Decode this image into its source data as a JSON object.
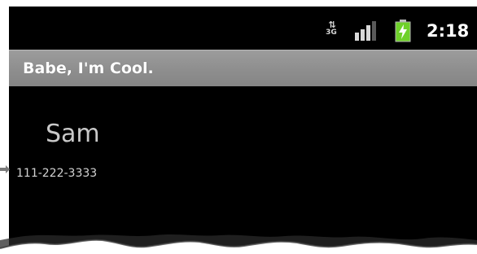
{
  "status_bar": {
    "network_label": "3G",
    "network_icon": "3g-data-arrows-icon",
    "signal_icon": "cell-signal-icon",
    "battery_icon": "battery-charging-icon",
    "time": "2:18",
    "accent_green": "#6fd12a"
  },
  "title_bar": {
    "title": "Babe, I'm Cool."
  },
  "contact": {
    "name": "Sam",
    "phone": "111-222-3333"
  },
  "colors": {
    "screen_background": "#000000",
    "title_bar_background": "#8e8e8e",
    "title_text": "#ffffff",
    "contact_text": "#c9c9c9"
  }
}
